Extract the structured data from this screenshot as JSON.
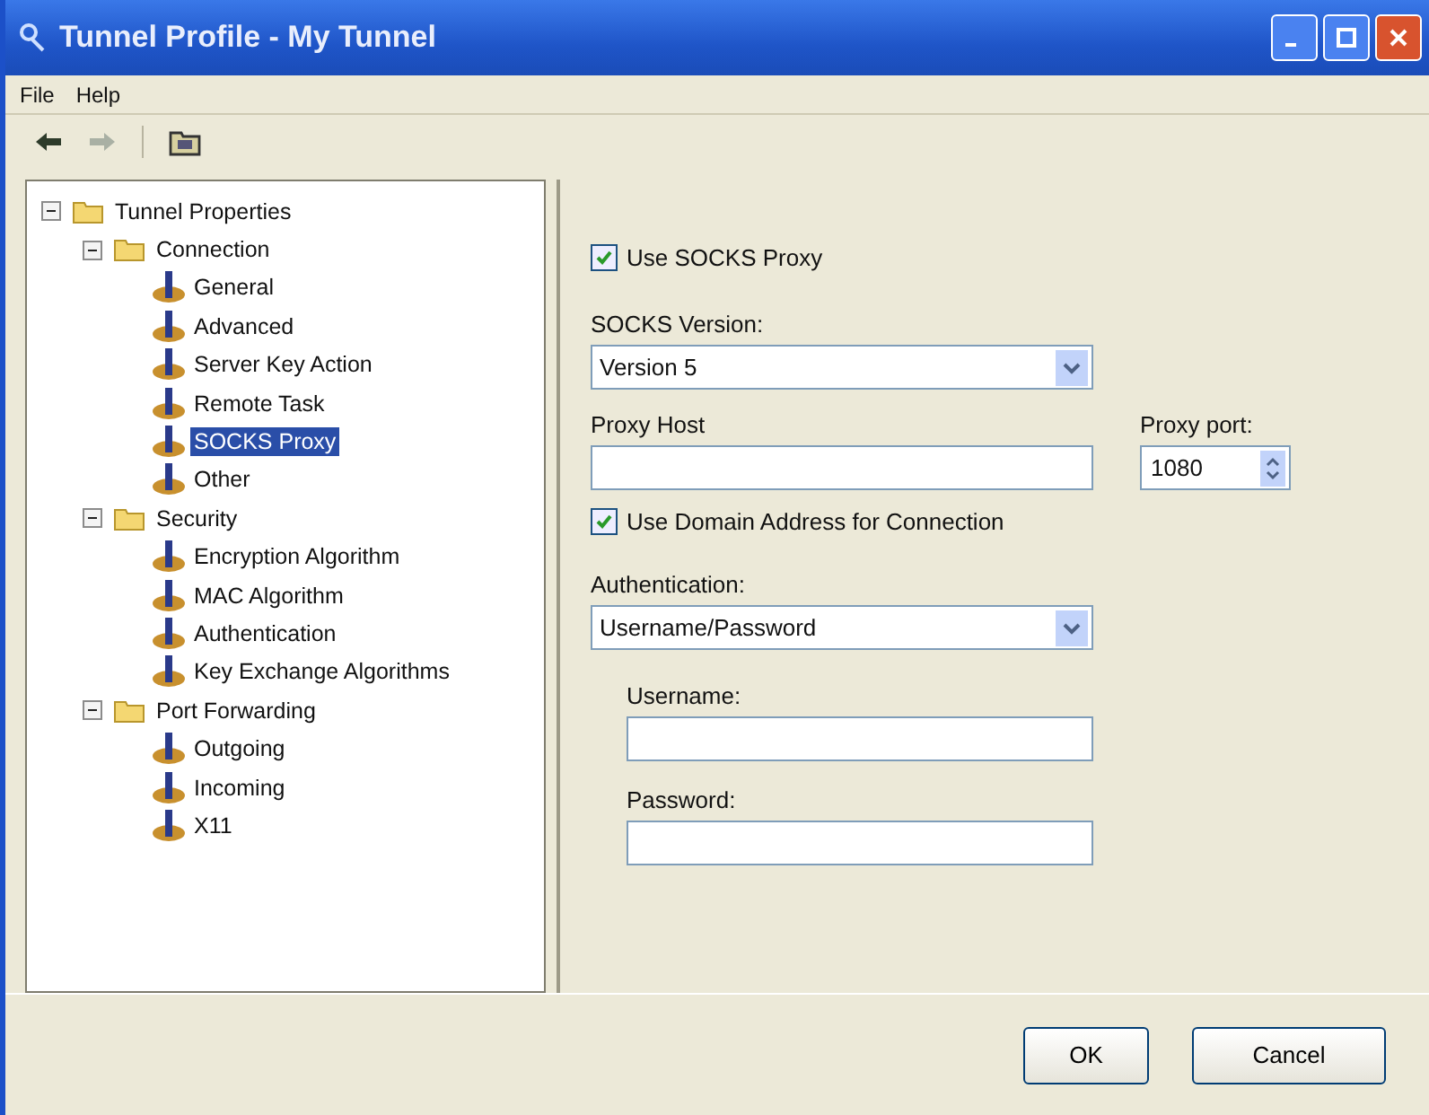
{
  "window": {
    "title": "Tunnel Profile - My Tunnel"
  },
  "menu": [
    "File",
    "Help"
  ],
  "tree": [
    {
      "label": "Tunnel Properties",
      "kind": "folder",
      "expanded": true,
      "children": [
        {
          "label": "Connection",
          "kind": "folder",
          "expanded": true,
          "children": [
            {
              "label": "General",
              "kind": "leaf",
              "selected": false
            },
            {
              "label": "Advanced",
              "kind": "leaf",
              "selected": false
            },
            {
              "label": "Server Key Action",
              "kind": "leaf",
              "selected": false
            },
            {
              "label": "Remote Task",
              "kind": "leaf",
              "selected": false
            },
            {
              "label": "SOCKS Proxy",
              "kind": "leaf",
              "selected": true
            },
            {
              "label": "Other",
              "kind": "leaf",
              "selected": false
            }
          ]
        },
        {
          "label": "Security",
          "kind": "folder",
          "expanded": true,
          "children": [
            {
              "label": "Encryption Algorithm",
              "kind": "leaf",
              "selected": false
            },
            {
              "label": "MAC Algorithm",
              "kind": "leaf",
              "selected": false
            },
            {
              "label": "Authentication",
              "kind": "leaf",
              "selected": false
            },
            {
              "label": "Key Exchange Algorithms",
              "kind": "leaf",
              "selected": false
            }
          ]
        },
        {
          "label": "Port Forwarding",
          "kind": "folder",
          "expanded": true,
          "children": [
            {
              "label": "Outgoing",
              "kind": "leaf",
              "selected": false
            },
            {
              "label": "Incoming",
              "kind": "leaf",
              "selected": false
            },
            {
              "label": "X11",
              "kind": "leaf",
              "selected": false
            }
          ]
        }
      ]
    }
  ],
  "form": {
    "use_socks": {
      "label": "Use SOCKS Proxy",
      "checked": true
    },
    "socks_version": {
      "label": "SOCKS Version:",
      "value": "Version 5"
    },
    "proxy_host": {
      "label": "Proxy Host"
    },
    "proxy_port": {
      "label": "Proxy port:",
      "value": "1080"
    },
    "use_domain": {
      "label": "Use Domain Address for Connection",
      "checked": true
    },
    "authentication": {
      "label": "Authentication:",
      "value": "Username/Password"
    },
    "username": {
      "label": "Username:"
    },
    "password": {
      "label": "Password:"
    }
  },
  "buttons": [
    "OK",
    "Cancel"
  ]
}
